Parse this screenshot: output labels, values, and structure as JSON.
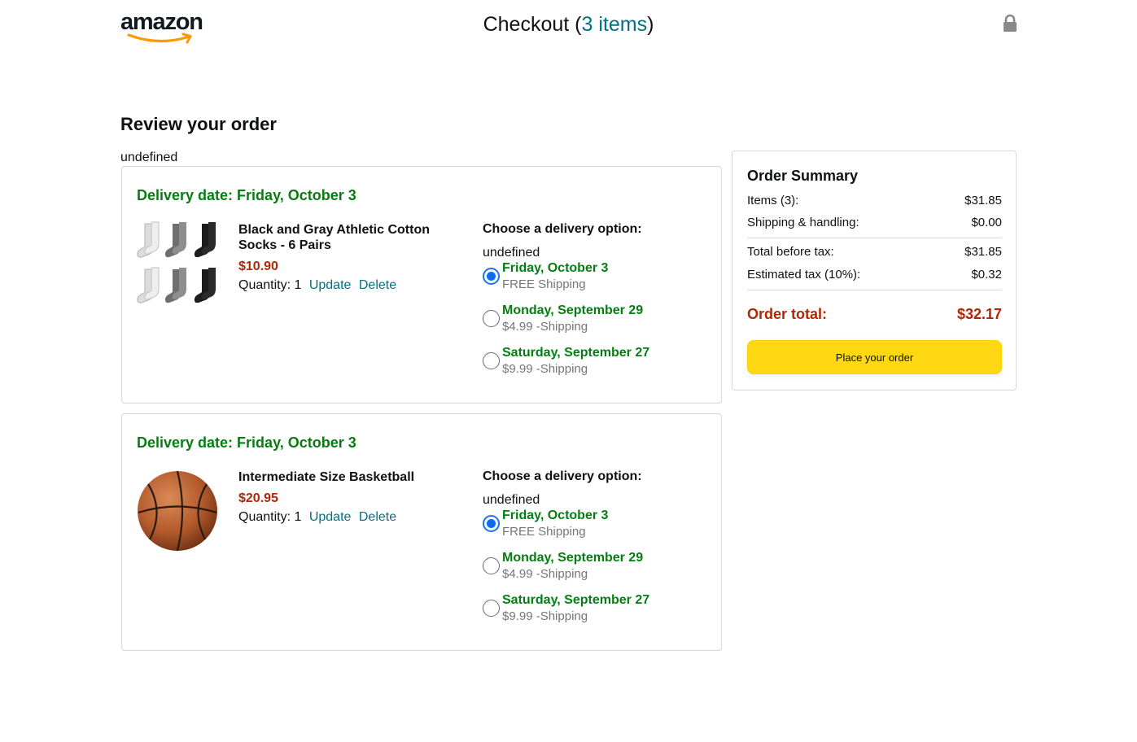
{
  "header": {
    "logo_text": "amazon",
    "checkout_label": "Checkout",
    "paren_open": "(",
    "items_link": "3 items",
    "paren_close": ")",
    "lock_icon": "lock-icon"
  },
  "review": {
    "title": "Review your order",
    "stray_text": "undefined"
  },
  "items": [
    {
      "delivery_date": "Delivery date: Friday, October 3",
      "image_icon": "socks-image",
      "name": "Black and Gray Athletic Cotton Socks - 6 Pairs",
      "price": "$10.90",
      "quantity_label": "Quantity: 1",
      "update_label": "Update",
      "delete_label": "Delete",
      "options_title": "Choose a delivery option:",
      "options_stray": "undefined",
      "options": [
        {
          "date": "Friday, October 3",
          "cost": "FREE Shipping",
          "checked": true
        },
        {
          "date": "Monday, September 29",
          "cost": "$4.99 -Shipping",
          "checked": false
        },
        {
          "date": "Saturday, September 27",
          "cost": "$9.99 -Shipping",
          "checked": false
        }
      ]
    },
    {
      "delivery_date": "Delivery date: Friday, October 3",
      "image_icon": "basketball-image",
      "name": "Intermediate Size Basketball",
      "price": "$20.95",
      "quantity_label": "Quantity: 1",
      "update_label": "Update",
      "delete_label": "Delete",
      "options_title": "Choose a delivery option:",
      "options_stray": "undefined",
      "options": [
        {
          "date": "Friday, October 3",
          "cost": "FREE Shipping",
          "checked": true
        },
        {
          "date": "Monday, September 29",
          "cost": "$4.99 -Shipping",
          "checked": false
        },
        {
          "date": "Saturday, September 27",
          "cost": "$9.99 -Shipping",
          "checked": false
        }
      ]
    }
  ],
  "summary": {
    "title": "Order Summary",
    "rows": [
      {
        "label": "Items (3):",
        "value": "$31.85"
      },
      {
        "label": "Shipping & handling:",
        "value": "$0.00"
      },
      {
        "label": "Total before tax:",
        "value": "$31.85"
      },
      {
        "label": "Estimated tax (10%):",
        "value": "$0.32"
      }
    ],
    "total_label": "Order total:",
    "total_value": "$32.17",
    "place_order_label": "Place your order"
  },
  "colors": {
    "green": "#067d12",
    "price_red": "#b12704",
    "link_teal": "#007185",
    "button_yellow": "#ffd814",
    "radio_blue": "#0b6ef0"
  }
}
